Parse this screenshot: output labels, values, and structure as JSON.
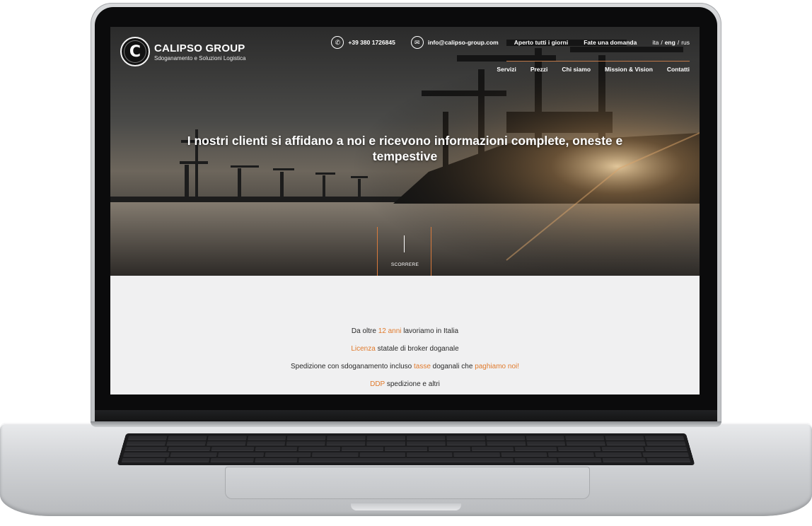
{
  "site": {
    "logo_letter": "C",
    "brand_name": "CALIPSO GROUP",
    "tagline": "Sdoganamento e Soluzioni Logistica"
  },
  "topbar": {
    "phone_icon": "phone-icon",
    "phone": "+39 380 1726845",
    "email_icon": "mail-icon",
    "email": "info@calipso-group.com",
    "hours": "Aperto tutti i giorni",
    "ask": "Fate una domanda",
    "languages": {
      "ita": "ita",
      "sep1": "/",
      "eng": "eng",
      "sep2": "/",
      "rus": "rus",
      "active": "eng"
    }
  },
  "nav": {
    "items": [
      "Servizi",
      "Prezzi",
      "Chi siamo",
      "Mission & Vision",
      "Contatti"
    ]
  },
  "hero": {
    "title": "I nostri clienti si affidano a noi e ricevono informazioni complete, oneste e tempestive",
    "scroll_label": "SCORRERE"
  },
  "features": [
    {
      "pre": "Da oltre ",
      "hl": "12 anni",
      "post": " lavoriamo in Italia"
    },
    {
      "pre": "",
      "hl": "Licenza",
      "post": " statale di broker doganale"
    },
    {
      "pre": "Spedizione con sdoganamento incluso ",
      "hl": "tasse",
      "post": " doganali che ",
      "hl2": "paghiamo noi!"
    },
    {
      "pre": "",
      "hl": "DDP",
      "post": " spedizione e altri"
    }
  ],
  "colors": {
    "accent": "#e07a2c",
    "hero_dark": "#2b2b2b",
    "content_bg": "#f0f0f1"
  }
}
